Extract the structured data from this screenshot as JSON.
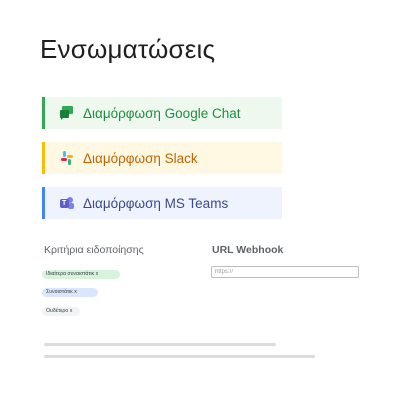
{
  "page": {
    "title": "Ενσωματώσεις"
  },
  "integrations": [
    {
      "label": "Διαμόρφωση Google Chat",
      "icon": "google-chat-icon",
      "accent": "#34a853"
    },
    {
      "label": "Διαμόρφωση Slack",
      "icon": "slack-icon",
      "accent": "#fbbc04"
    },
    {
      "label": "Διαμόρφωση MS Teams",
      "icon": "ms-teams-icon",
      "accent": "#4285f4"
    }
  ],
  "criteria": {
    "label": "Κριτήρια ειδοποίησης",
    "chips": [
      {
        "label": "Ιδιαίτερα συναιστάτικ x",
        "color": "#d7f3dc"
      },
      {
        "label": "Συναιστάτικ x",
        "color": "#d9e6fc"
      },
      {
        "label": "Ουδέτερο x",
        "color": "#f1f3f4"
      }
    ]
  },
  "webhook": {
    "label": "URL Webhook",
    "placeholder": "https://"
  }
}
